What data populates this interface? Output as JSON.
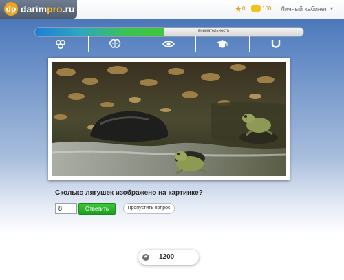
{
  "header": {
    "logo_mark": "dp",
    "logo_main": "darim",
    "logo_accent": "pro",
    "logo_suffix": ".ru",
    "stars": "0",
    "coins": "100",
    "account_label": "Личный кабинет",
    "caret": "▾"
  },
  "progress": {
    "label": "внимательность",
    "fraction": 0.48
  },
  "tabs": [
    {
      "icon": "molecule-icon"
    },
    {
      "icon": "brain-icon"
    },
    {
      "icon": "eye-icon"
    },
    {
      "icon": "graduation-cap-icon"
    },
    {
      "icon": "horseshoe-icon"
    }
  ],
  "quiz": {
    "question": "Сколько лягушек изображено на картинке?",
    "answer_value": "8",
    "answer_button": "Ответить",
    "skip_button": "Пропустить вопрос"
  },
  "score": {
    "icon": "★",
    "value": "1200"
  },
  "colors": {
    "accent": "#f5b630",
    "progress_start": "#1e7fd6",
    "progress_end": "#40c63a",
    "answer_button": "#2aae2a"
  }
}
